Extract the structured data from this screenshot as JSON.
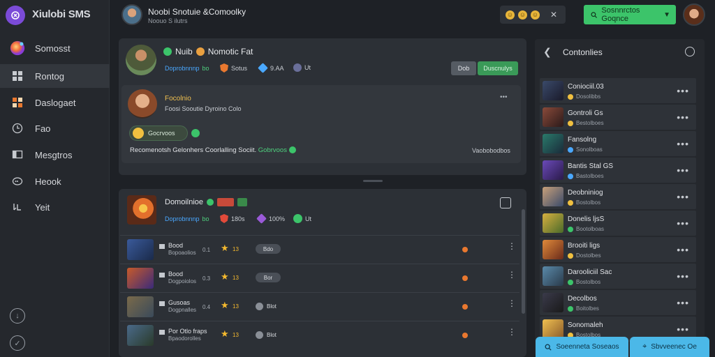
{
  "app": {
    "logo_text": "Xiulobi SMS"
  },
  "sidebar": {
    "items": [
      {
        "label": "Somosst",
        "icon": "planet-icon"
      },
      {
        "label": "Rontog",
        "icon": "grid-icon"
      },
      {
        "label": "Daslogaet",
        "icon": "puzzle-icon"
      },
      {
        "label": "Fao",
        "icon": "clock-icon"
      },
      {
        "label": "Mesgtros",
        "icon": "message-icon"
      },
      {
        "label": "Heook",
        "icon": "chat-icon"
      },
      {
        "label": "Yeit",
        "icon": "gamepad-icon"
      }
    ]
  },
  "header": {
    "title": "Noobi Snotuie &Comoolky",
    "subtitle": "Noouo S ilutrs",
    "primary_button": "Sosnnrctos Goqnce",
    "close_glyph": "✕"
  },
  "profile_card": {
    "name": "Nuib",
    "game": "Nomotic Fat",
    "tagline": "Doprobnnnp",
    "tag1": "bo",
    "stat1": "Sotus",
    "stat2": "9.AA",
    "stat3": "Ut",
    "btn_secondary": "Dob",
    "btn_primary": "Duscnulys",
    "inner": {
      "name": "Focolnio",
      "sub": "Foosi Sooutie Dyroino Colo",
      "chip": "Gocrvoos",
      "body_text": "Recomenotsh Gelonhers Coorlalling Sociit.",
      "body_link": "Gobrvoos",
      "right_text": "Vaobobodbos",
      "more": "•••"
    }
  },
  "game_card": {
    "title": "Domoilnioe",
    "tagline": "Doprobnnnp",
    "tag1": "bo",
    "stat1": "180s",
    "stat2": "100%",
    "stat3": "Ut",
    "rows": [
      {
        "title": "Bood",
        "sub": "Bopoaolios",
        "v1": "0.1",
        "rating": "13",
        "tag": "Bdo"
      },
      {
        "title": "Bood",
        "sub": "Dogpoiolos",
        "v1": "0.3",
        "rating": "13",
        "tag": "Bor"
      },
      {
        "title": "Gusoas",
        "sub": "Dogpnalles",
        "v1": "0.4",
        "rating": "13",
        "tag": "Blot"
      },
      {
        "title": "Por Otlo fraps",
        "sub": "Bpaodorolles",
        "v1": "0.3",
        "rating": "13",
        "tag": "Blot"
      }
    ]
  },
  "right_panel": {
    "title": "Contonlies",
    "items": [
      {
        "name": "Coniociil.03",
        "sub": "Dosolibbs"
      },
      {
        "name": "Gontroli Gs",
        "sub": "Bestolboes"
      },
      {
        "name": "Fansolng",
        "sub": "Sonolboas"
      },
      {
        "name": "Bantis Stal GS",
        "sub": "Bastolboes"
      },
      {
        "name": "Deobniniog",
        "sub": "Bostolbos"
      },
      {
        "name": "Donelis ljsS",
        "sub": "Bootolboas"
      },
      {
        "name": "Brooiti ligs",
        "sub": "Dostolbes"
      },
      {
        "name": "Darooliciil Sac",
        "sub": "Bostolbos"
      },
      {
        "name": "Decolbos",
        "sub": "Boitolbes"
      },
      {
        "name": "Sonomaleh",
        "sub": "Bostolbos"
      }
    ],
    "btn_left": "Soeenneta Soseaos",
    "btn_right": "Sbvveenec Oe"
  },
  "colors": {
    "accent_green": "#3cc46a",
    "accent_blue": "#4bb8e8",
    "link_blue": "#4aa8ff",
    "star": "#f4b92e",
    "orange_dot": "#e9782f"
  }
}
